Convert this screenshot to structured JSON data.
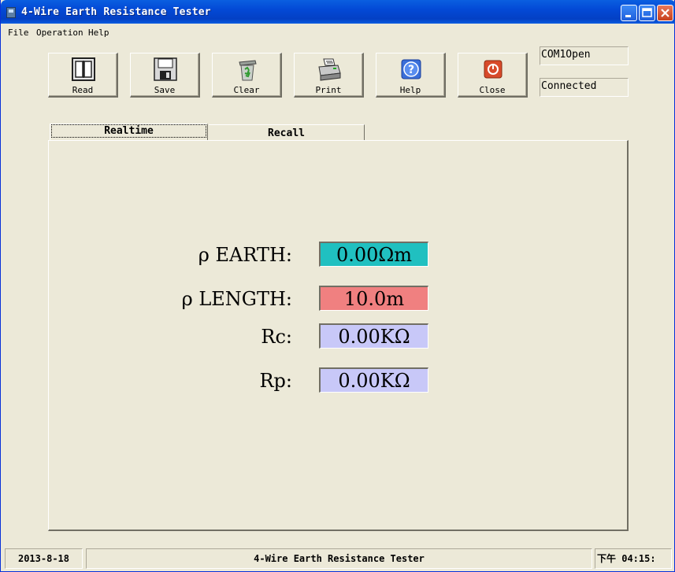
{
  "window": {
    "title": "4-Wire Earth Resistance Tester"
  },
  "menu": [
    "File",
    "Operation",
    "Help"
  ],
  "toolbar": {
    "read": "Read",
    "save": "Save",
    "clear": "Clear",
    "print": "Print",
    "help": "Help",
    "close": "Close"
  },
  "status_boxes": {
    "port": "COM1Open",
    "connection": "Connected"
  },
  "tabs": {
    "realtime": "Realtime",
    "recall": "Recall"
  },
  "measurements": {
    "earth": {
      "label": "ρ  EARTH:",
      "value": "0.00Ωm",
      "color": "#20c0c0"
    },
    "length": {
      "label": "ρ  LENGTH:",
      "value": "10.0m",
      "color": "#f08080"
    },
    "rc": {
      "label": "Rc:",
      "value": "0.00KΩ",
      "color": "#c8c8f8"
    },
    "rp": {
      "label": "Rp:",
      "value": "0.00KΩ",
      "color": "#c8c8f8"
    }
  },
  "statusbar": {
    "date": "2013-8-18",
    "app_name": "4-Wire Earth Resistance Tester",
    "time": "下午 04:15:"
  },
  "colors": {
    "titlebar": "#0349d6",
    "background": "#ece9d8"
  }
}
